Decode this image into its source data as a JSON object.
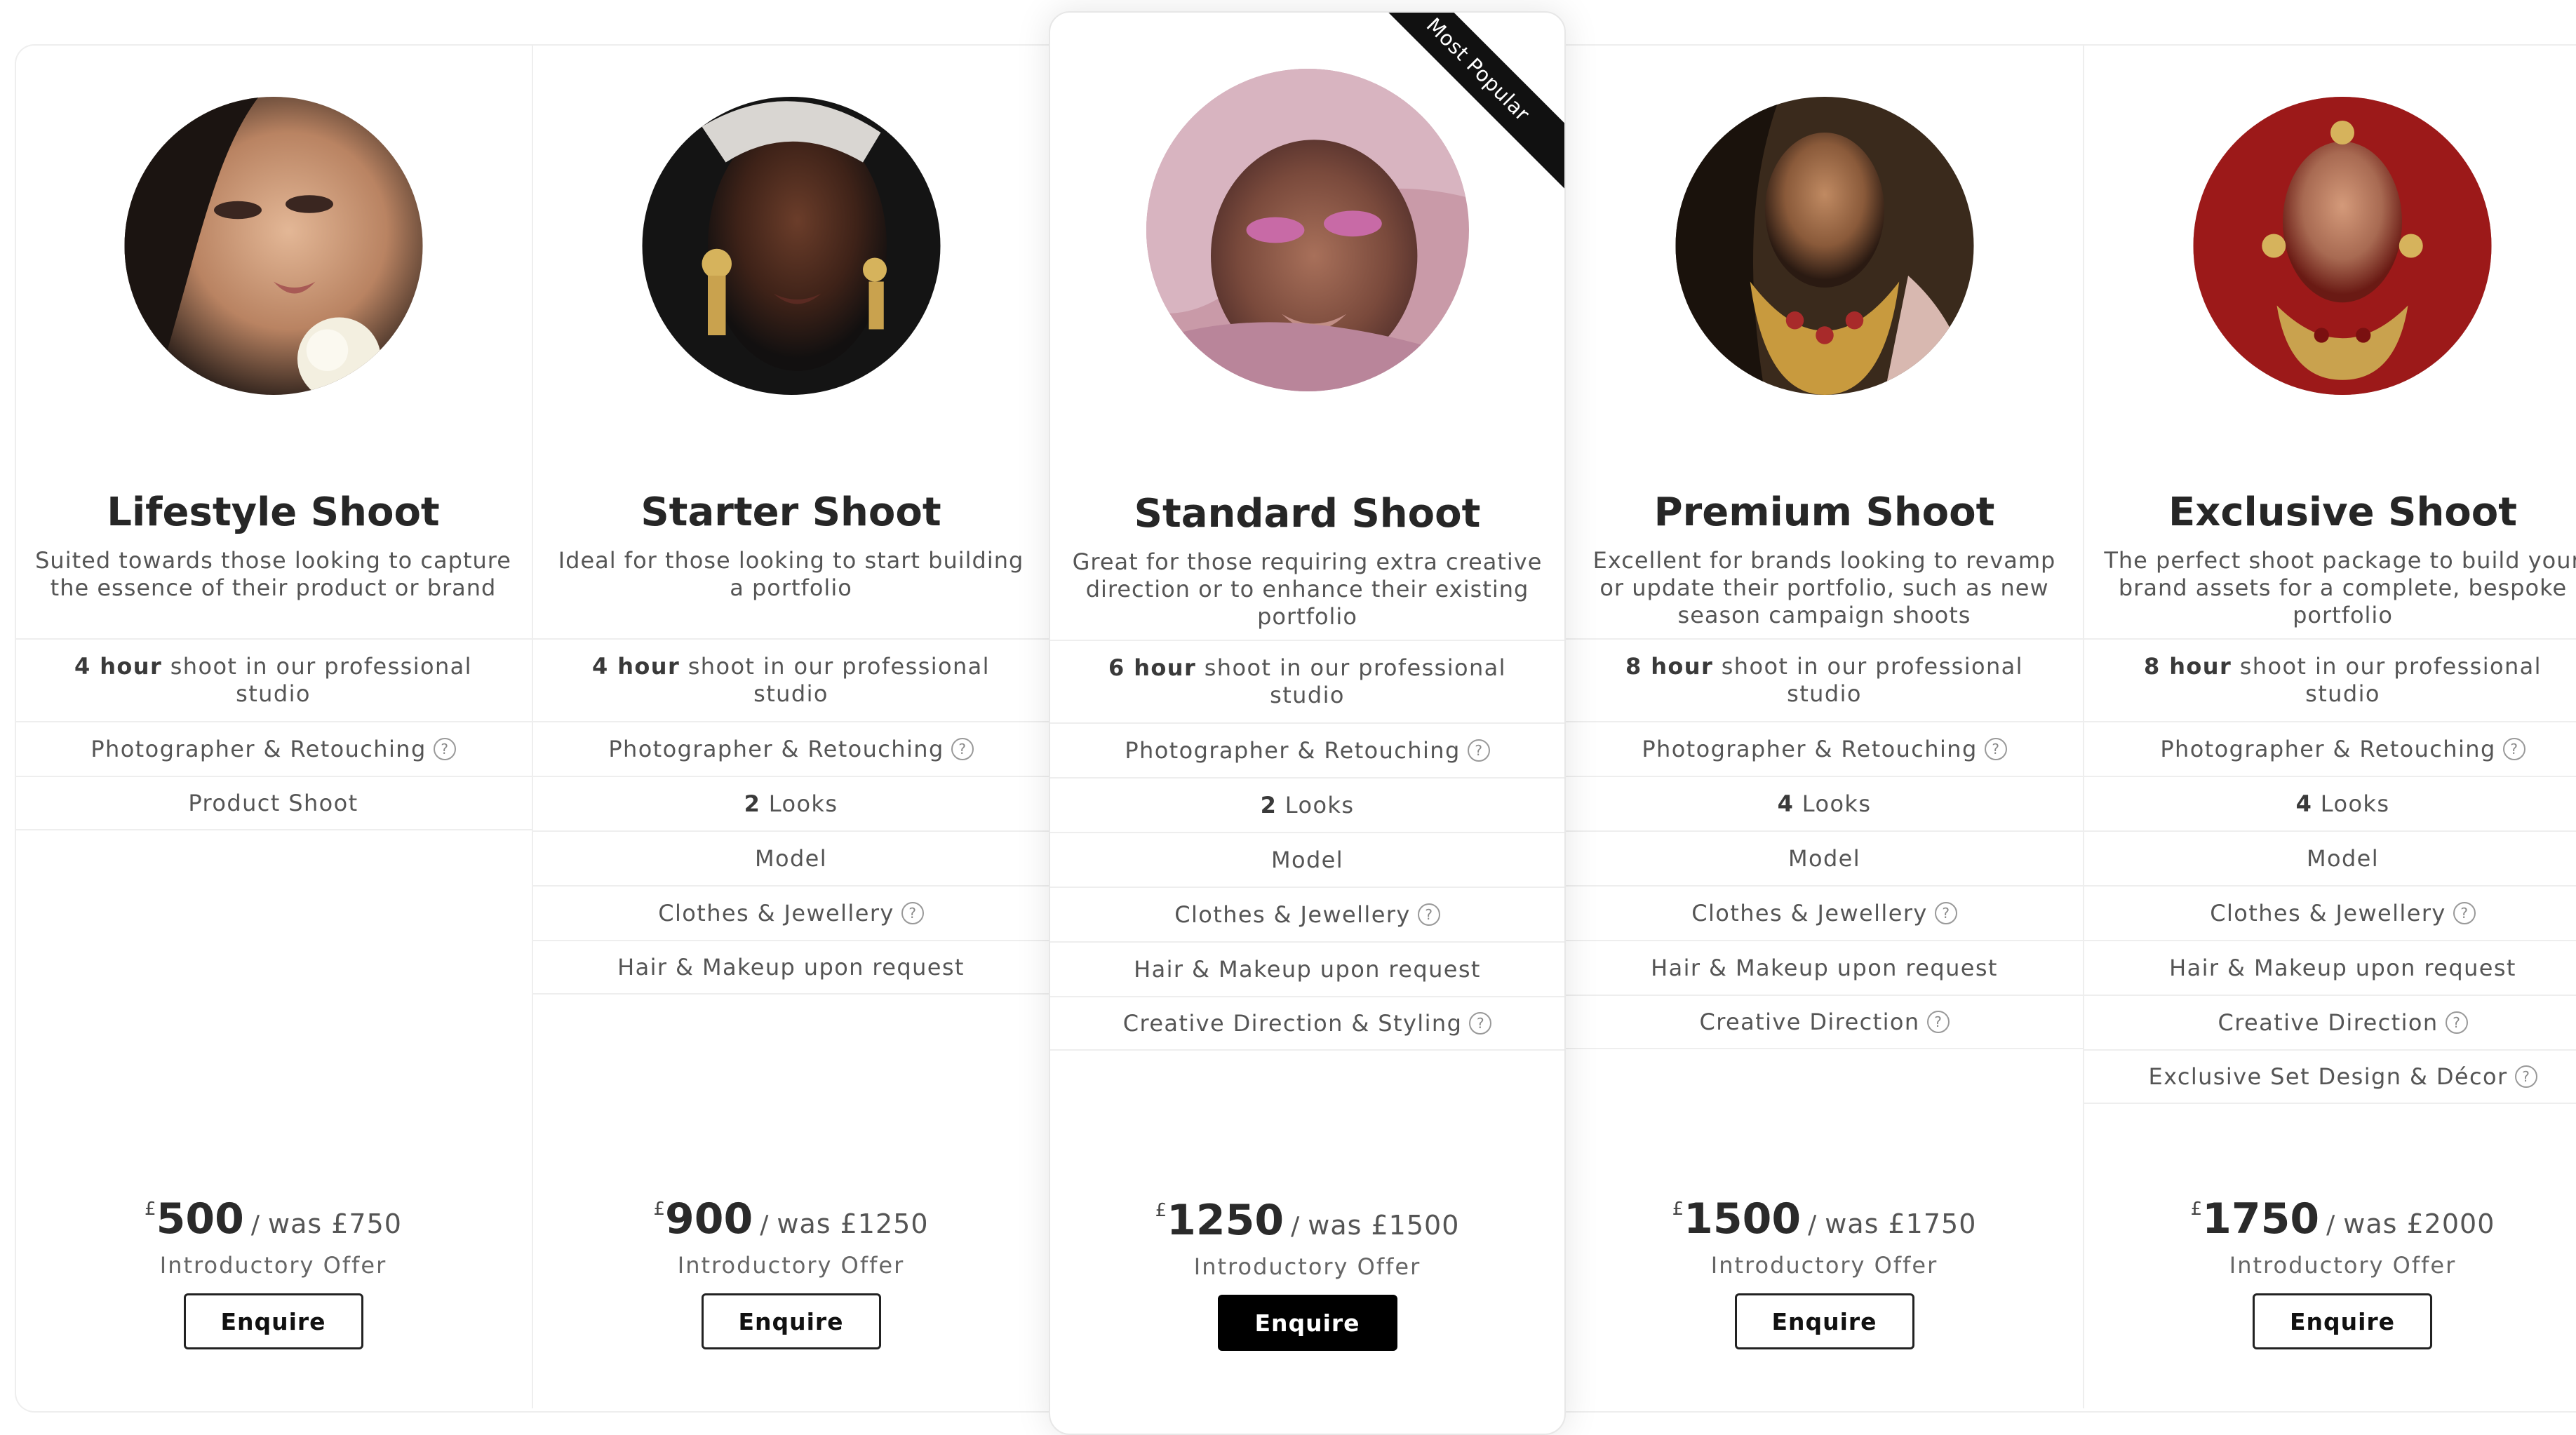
{
  "badge": "Most Popular",
  "plans": [
    {
      "title": "Lifestyle Shoot",
      "description": "Suited towards those looking to capture the essence of their product or brand",
      "features": [
        {
          "bold": "4 hour",
          "text": " shoot in our professional studio"
        },
        {
          "text": "Photographer & Retouching",
          "info": "?"
        },
        {
          "text": "Product Shoot"
        }
      ],
      "currency": "£",
      "price": "500",
      "slash": "/",
      "was": "was £750",
      "offer": "Introductory Offer",
      "button": "Enquire"
    },
    {
      "title": "Starter Shoot",
      "description": "Ideal for those looking to start building a portfolio",
      "features": [
        {
          "bold": "4 hour",
          "text": " shoot in our professional studio"
        },
        {
          "text": "Photographer & Retouching",
          "info": "?"
        },
        {
          "bold": "2",
          "text": " Looks"
        },
        {
          "text": "Model"
        },
        {
          "text": "Clothes & Jewellery",
          "info": "?"
        },
        {
          "text": "Hair & Makeup upon request"
        }
      ],
      "currency": "£",
      "price": "900",
      "slash": "/",
      "was": "was £1250",
      "offer": "Introductory Offer",
      "button": "Enquire"
    },
    {
      "title": "Standard Shoot",
      "description": "Great for those requiring extra creative direction or to enhance their existing portfolio",
      "features": [
        {
          "bold": "6 hour",
          "text": " shoot in our professional studio"
        },
        {
          "text": "Photographer & Retouching",
          "info": "?"
        },
        {
          "bold": "2",
          "text": " Looks"
        },
        {
          "text": "Model"
        },
        {
          "text": "Clothes & Jewellery",
          "info": "?"
        },
        {
          "text": "Hair & Makeup upon request"
        },
        {
          "text": "Creative Direction & Styling",
          "info": "?"
        }
      ],
      "currency": "£",
      "price": "1250",
      "slash": "/",
      "was": "was £1500",
      "offer": "Introductory Offer",
      "button": "Enquire"
    },
    {
      "title": "Premium Shoot",
      "description": "Excellent for brands looking to revamp or update their portfolio, such as new season campaign shoots",
      "features": [
        {
          "bold": "8 hour",
          "text": " shoot in our professional studio"
        },
        {
          "text": "Photographer & Retouching",
          "info": "?"
        },
        {
          "bold": "4",
          "text": " Looks"
        },
        {
          "text": "Model"
        },
        {
          "text": "Clothes & Jewellery",
          "info": "?"
        },
        {
          "text": "Hair & Makeup upon request"
        },
        {
          "text": "Creative Direction",
          "info": "?"
        }
      ],
      "currency": "£",
      "price": "1500",
      "slash": "/",
      "was": "was £1750",
      "offer": "Introductory Offer",
      "button": "Enquire"
    },
    {
      "title": "Exclusive Shoot",
      "description": "The perfect shoot package to build your brand assets for a complete, bespoke portfolio",
      "features": [
        {
          "bold": "8 hour",
          "text": " shoot in our professional studio"
        },
        {
          "text": "Photographer & Retouching",
          "info": "?"
        },
        {
          "bold": "4",
          "text": " Looks"
        },
        {
          "text": "Model"
        },
        {
          "text": "Clothes & Jewellery",
          "info": "?"
        },
        {
          "text": "Hair & Makeup upon request"
        },
        {
          "text": "Creative Direction",
          "info": "?"
        },
        {
          "text": "Exclusive Set Design & Décor",
          "info": "?"
        }
      ],
      "currency": "£",
      "price": "1750",
      "slash": "/",
      "was": "was £2000",
      "offer": "Introductory Offer",
      "button": "Enquire"
    }
  ],
  "colors": {
    "text_dark": "#262626",
    "text_body": "#555555",
    "divider": "#eeeeee",
    "featured_button": "#000000",
    "ribbon": "#111111"
  }
}
